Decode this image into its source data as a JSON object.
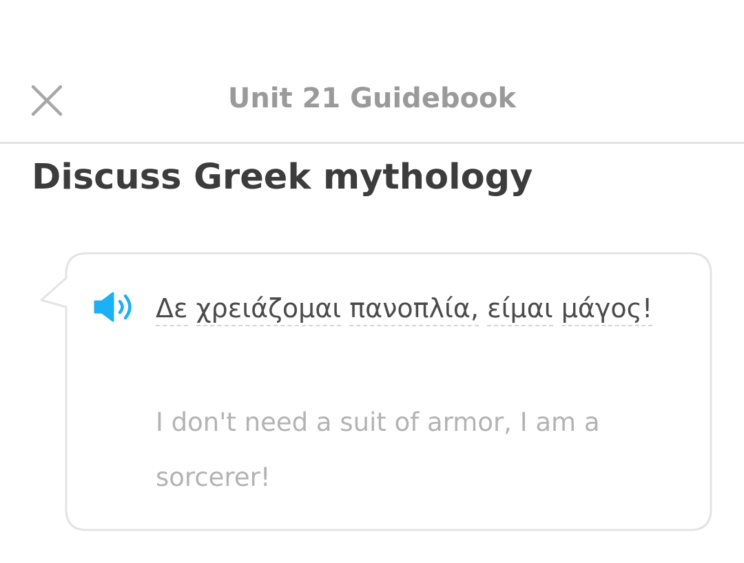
{
  "header": {
    "title": "Unit 21 Guidebook",
    "close_icon": "close-icon"
  },
  "section": {
    "title": "Discuss Greek mythology"
  },
  "phrase_card": {
    "speaker_icon": "speaker-icon",
    "accent_color": "#1cb0f6",
    "greek_words": [
      "Δε",
      "χρειάζομαι",
      "πανοπλία,",
      "είμαι",
      "μάγος!"
    ],
    "translation": "I don't need a suit of armor, I am a sorcerer!"
  }
}
